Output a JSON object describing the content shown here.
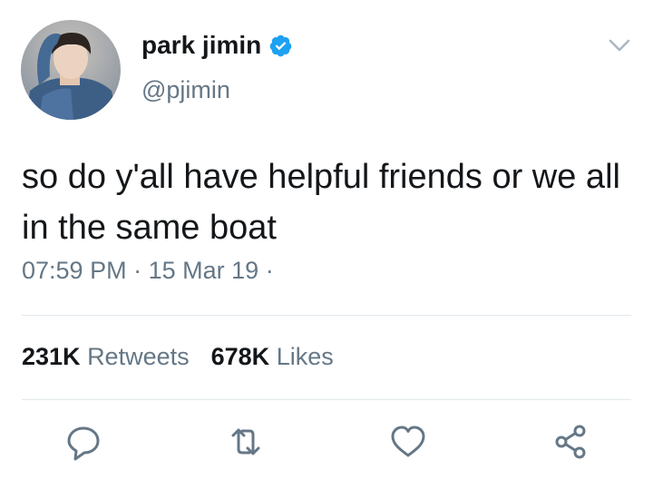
{
  "user": {
    "display_name": "park jimin",
    "handle": "@pjimin",
    "verified": true
  },
  "tweet": {
    "text": "so do y'all have helpful friends or we all in the same boat",
    "time": "07:59 PM",
    "date": "15 Mar 19",
    "separator": "·"
  },
  "stats": {
    "retweets_count": "231K",
    "retweets_label": "Retweets",
    "likes_count": "678K",
    "likes_label": "Likes"
  },
  "actions": [
    "reply-icon",
    "retweet-icon",
    "like-icon",
    "share-icon"
  ],
  "colors": {
    "text": "#14171a",
    "secondary": "#657786",
    "verified_blue": "#1da1f2",
    "divider": "#e1e8ed"
  }
}
